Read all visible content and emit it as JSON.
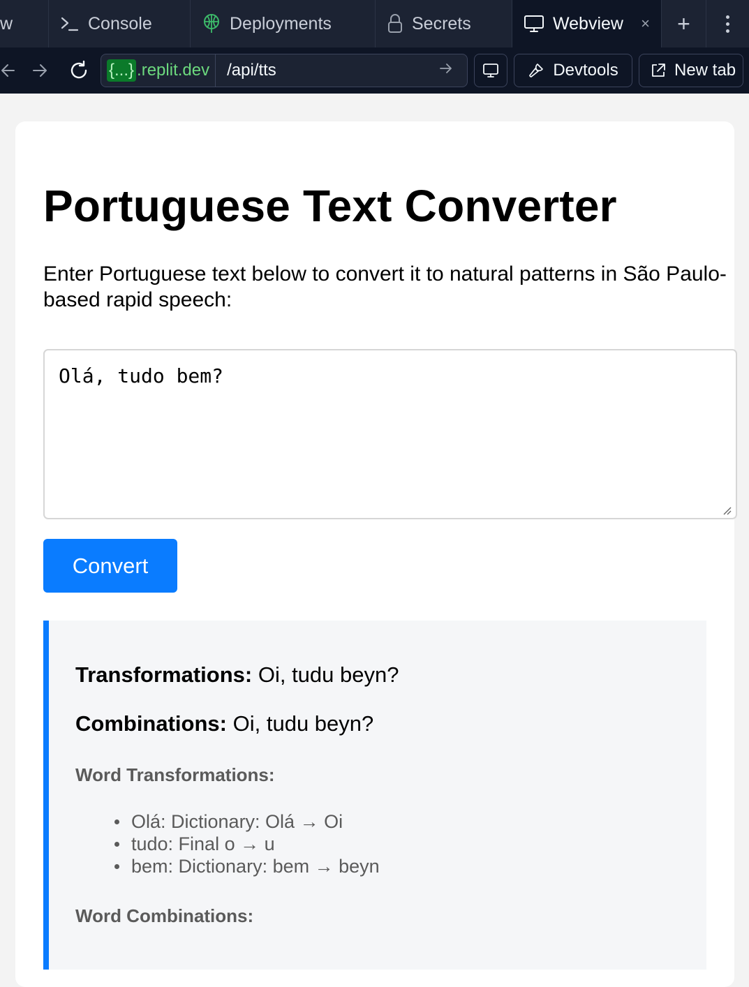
{
  "tabs": {
    "partial_label": "w",
    "console": {
      "label": "Console",
      "icon": "terminal-prompt-icon"
    },
    "deployments": {
      "label": "Deployments",
      "icon": "deployments-icon"
    },
    "secrets": {
      "label": "Secrets",
      "icon": "lock-icon"
    },
    "webview": {
      "label": "Webview",
      "icon": "monitor-icon",
      "close": "×"
    },
    "add": "+"
  },
  "address_bar": {
    "host_prefix": "{...}",
    "host_domain": ".replit.dev",
    "path": "/api/tts",
    "devtools_label": "Devtools",
    "new_tab_label": "New tab"
  },
  "page": {
    "title": "Portuguese Text Converter",
    "intro": "Enter Portuguese text below to convert it to natural patterns in São Paulo-based rapid speech:",
    "input_value": "Olá, tudo bem?",
    "convert_label": "Convert",
    "accent_color": "#0a7cff"
  },
  "result": {
    "transformations_label": "Transformations:",
    "transformations_value": "Oi, tudu beyn?",
    "combinations_label": "Combinations:",
    "combinations_value": "Oi, tudu beyn?",
    "word_transformations_heading": "Word Transformations:",
    "word_transformations": [
      "Olá: Dictionary: Olá → Oi",
      "tudo: Final o → u",
      "bem: Dictionary: bem → beyn"
    ],
    "word_combinations_heading": "Word Combinations:"
  }
}
